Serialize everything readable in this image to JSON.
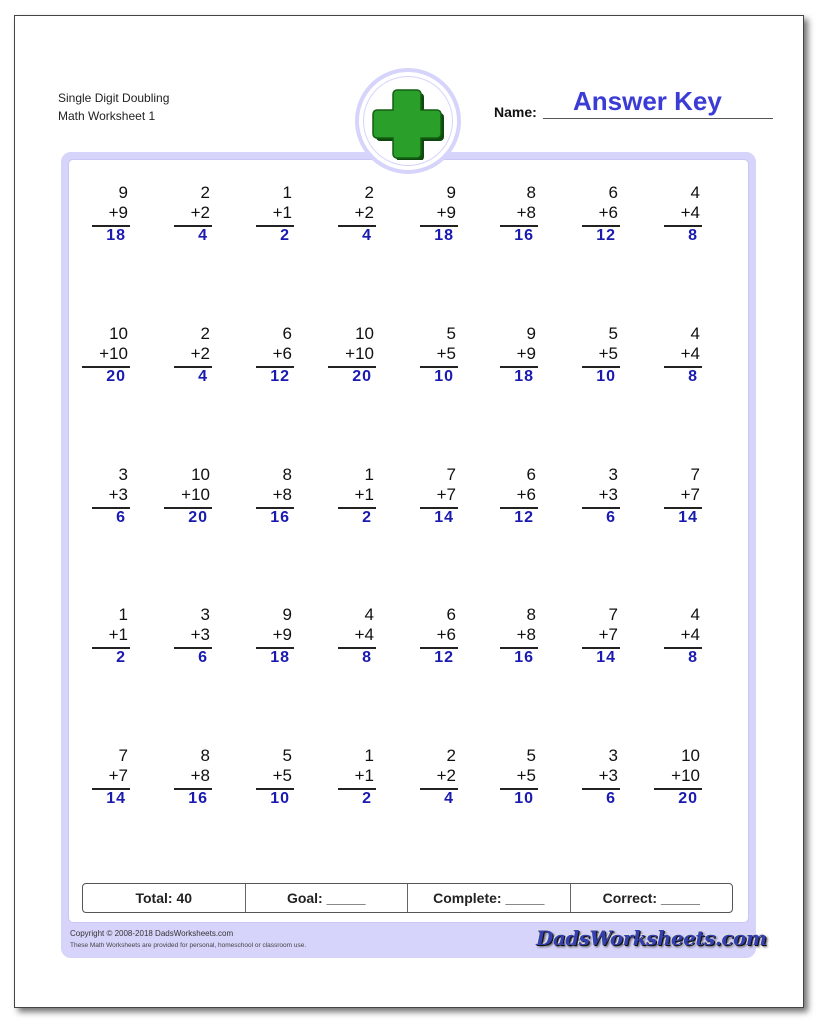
{
  "header": {
    "title_line1": "Single Digit Doubling",
    "title_line2": "Math Worksheet 1",
    "name_label": "Name:",
    "name_value": "Answer Key",
    "logo_icon": "green-plus-icon"
  },
  "colors": {
    "answer": "#1a1ab0",
    "name_value": "#3b3bd6",
    "frame": "#d6d4fb",
    "plus_green": "#2aa02a"
  },
  "problems": [
    [
      {
        "a": "9",
        "b": "+9",
        "ans": "18"
      },
      {
        "a": "2",
        "b": "+2",
        "ans": "4"
      },
      {
        "a": "1",
        "b": "+1",
        "ans": "2"
      },
      {
        "a": "2",
        "b": "+2",
        "ans": "4"
      },
      {
        "a": "9",
        "b": "+9",
        "ans": "18"
      },
      {
        "a": "8",
        "b": "+8",
        "ans": "16"
      },
      {
        "a": "6",
        "b": "+6",
        "ans": "12"
      },
      {
        "a": "4",
        "b": "+4",
        "ans": "8"
      }
    ],
    [
      {
        "a": "10",
        "b": "+10",
        "ans": "20"
      },
      {
        "a": "2",
        "b": "+2",
        "ans": "4"
      },
      {
        "a": "6",
        "b": "+6",
        "ans": "12"
      },
      {
        "a": "10",
        "b": "+10",
        "ans": "20"
      },
      {
        "a": "5",
        "b": "+5",
        "ans": "10"
      },
      {
        "a": "9",
        "b": "+9",
        "ans": "18"
      },
      {
        "a": "5",
        "b": "+5",
        "ans": "10"
      },
      {
        "a": "4",
        "b": "+4",
        "ans": "8"
      }
    ],
    [
      {
        "a": "3",
        "b": "+3",
        "ans": "6"
      },
      {
        "a": "10",
        "b": "+10",
        "ans": "20"
      },
      {
        "a": "8",
        "b": "+8",
        "ans": "16"
      },
      {
        "a": "1",
        "b": "+1",
        "ans": "2"
      },
      {
        "a": "7",
        "b": "+7",
        "ans": "14"
      },
      {
        "a": "6",
        "b": "+6",
        "ans": "12"
      },
      {
        "a": "3",
        "b": "+3",
        "ans": "6"
      },
      {
        "a": "7",
        "b": "+7",
        "ans": "14"
      }
    ],
    [
      {
        "a": "1",
        "b": "+1",
        "ans": "2"
      },
      {
        "a": "3",
        "b": "+3",
        "ans": "6"
      },
      {
        "a": "9",
        "b": "+9",
        "ans": "18"
      },
      {
        "a": "4",
        "b": "+4",
        "ans": "8"
      },
      {
        "a": "6",
        "b": "+6",
        "ans": "12"
      },
      {
        "a": "8",
        "b": "+8",
        "ans": "16"
      },
      {
        "a": "7",
        "b": "+7",
        "ans": "14"
      },
      {
        "a": "4",
        "b": "+4",
        "ans": "8"
      }
    ],
    [
      {
        "a": "7",
        "b": "+7",
        "ans": "14"
      },
      {
        "a": "8",
        "b": "+8",
        "ans": "16"
      },
      {
        "a": "5",
        "b": "+5",
        "ans": "10"
      },
      {
        "a": "1",
        "b": "+1",
        "ans": "2"
      },
      {
        "a": "2",
        "b": "+2",
        "ans": "4"
      },
      {
        "a": "5",
        "b": "+5",
        "ans": "10"
      },
      {
        "a": "3",
        "b": "+3",
        "ans": "6"
      },
      {
        "a": "10",
        "b": "+10",
        "ans": "20"
      }
    ]
  ],
  "summary": {
    "total": "Total: 40",
    "goal": "Goal: _____",
    "complete": "Complete: _____",
    "correct": "Correct: _____"
  },
  "footer": {
    "copyright": "Copyright © 2008-2018 DadsWorksheets.com",
    "usage": "These Math Worksheets are provided for personal, homeschool or classroom use.",
    "brand": "DadsWorksheets.com"
  }
}
